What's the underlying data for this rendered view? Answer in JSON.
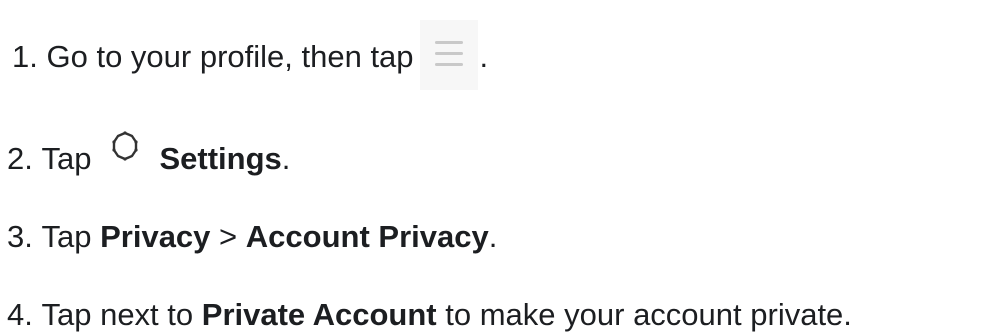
{
  "steps": [
    {
      "number": "1.",
      "text_before": "Go to your profile, then tap",
      "icon": "hamburger-menu-icon",
      "text_after": "."
    },
    {
      "number": "2.",
      "text_before": "Tap",
      "icon": "gear-icon",
      "bold": "Settings",
      "text_after": "."
    },
    {
      "number": "3.",
      "text_before": "Tap",
      "bold1": "Privacy",
      "separator": ">",
      "bold2": "Account Privacy",
      "text_after": "."
    },
    {
      "number": "4.",
      "text_before": "Tap next to",
      "bold": "Private Account",
      "text_after": "to make your account private."
    }
  ],
  "colors": {
    "text": "#1c1e21",
    "icon_bg": "#f7f7f7",
    "menu_icon": "#c9c9c9",
    "gear_icon": "#333333"
  }
}
